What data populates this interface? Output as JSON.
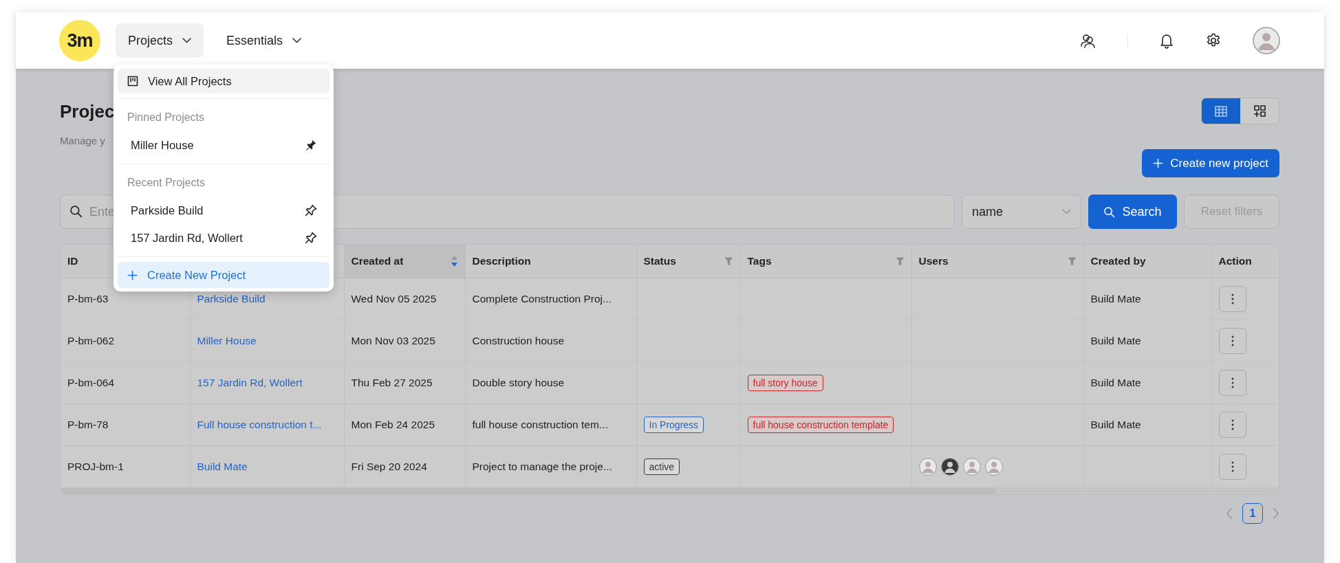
{
  "header": {
    "logo": "3m",
    "nav": [
      {
        "label": "Projects",
        "open": true
      },
      {
        "label": "Essentials",
        "open": false
      }
    ]
  },
  "projects_menu": {
    "view_all": {
      "label": "View All Projects",
      "highlighted": true
    },
    "sections": [
      {
        "title": "Pinned Projects",
        "items": [
          {
            "label": "Miller House",
            "pinned": true
          }
        ]
      },
      {
        "title": "Recent Projects",
        "items": [
          {
            "label": "Parkside Build",
            "pinned": false
          },
          {
            "label": "157 Jardin Rd, Wollert",
            "pinned": false
          }
        ]
      }
    ],
    "create": {
      "label": "Create New Project"
    }
  },
  "page": {
    "title": "Projec",
    "subtitle": "Manage y"
  },
  "view_toggle": [
    {
      "kind": "table",
      "selected": true
    },
    {
      "kind": "grid",
      "selected": false
    }
  ],
  "create_button": {
    "label": "Create new project"
  },
  "search": {
    "placeholder": "Ente",
    "field": "name",
    "button": "Search",
    "reset": {
      "label": "Reset filters",
      "disabled": true
    }
  },
  "table": {
    "columns": [
      {
        "label": "ID"
      },
      {},
      {
        "label": "Created at",
        "filter": false,
        "sorted": true
      },
      {
        "label": "Description",
        "filter": false,
        "sorted": false
      },
      {
        "label": "Status",
        "filter": true,
        "sorted": false
      },
      {
        "label": "Tags",
        "filter": true,
        "sorted": false
      },
      {
        "label": "Users",
        "filter": true,
        "sorted": false
      },
      {
        "label": "Created by",
        "filter": false,
        "sorted": false
      },
      {
        "label": "Action",
        "filter": false,
        "sorted": false
      }
    ],
    "rows": [
      {
        "id": "P-bm-63",
        "name": "Parkside Build",
        "created_at": "Wed Nov 05 2025",
        "description": "Complete Construction Proj...",
        "tags": [],
        "users": [],
        "created_by": "Build Mate"
      },
      {
        "id": "P-bm-062",
        "name": "Miller House",
        "created_at": "Mon Nov 03 2025",
        "description": "Construction house",
        "tags": [],
        "users": [],
        "created_by": "Build Mate"
      },
      {
        "id": "P-bm-064",
        "name": "157 Jardin Rd, Wollert",
        "created_at": "Thu Feb 27 2025",
        "description": "Double story house",
        "tags": [
          {
            "label": "full story house",
            "color": "#c0282d"
          }
        ],
        "users": [],
        "created_by": "Build Mate"
      },
      {
        "id": "P-bm-78",
        "name": "Full house construction t...",
        "created_at": "Mon Feb 24 2025",
        "description": "full house construction tem...",
        "status": {
          "label": "In Progress",
          "color": "#2a62b8"
        },
        "tags": [
          {
            "label": "full house construction template",
            "color": "#c0282d"
          }
        ],
        "users": [],
        "created_by": "Build Mate"
      },
      {
        "id": "PROJ-bm-1",
        "name": "Build Mate",
        "created_at": "Fri Sep 20 2024",
        "description": "Project to manage the proje...",
        "status": {
          "label": "active",
          "color": "#3a3a3a"
        },
        "tags": [],
        "users": [
          {
            "kind": "placeholder"
          },
          {
            "kind": "photo"
          },
          {
            "kind": "placeholder"
          },
          {
            "kind": "placeholder"
          }
        ]
      }
    ]
  },
  "pagination": {
    "pages": [
      {
        "label": "1",
        "selected": true
      }
    ]
  }
}
